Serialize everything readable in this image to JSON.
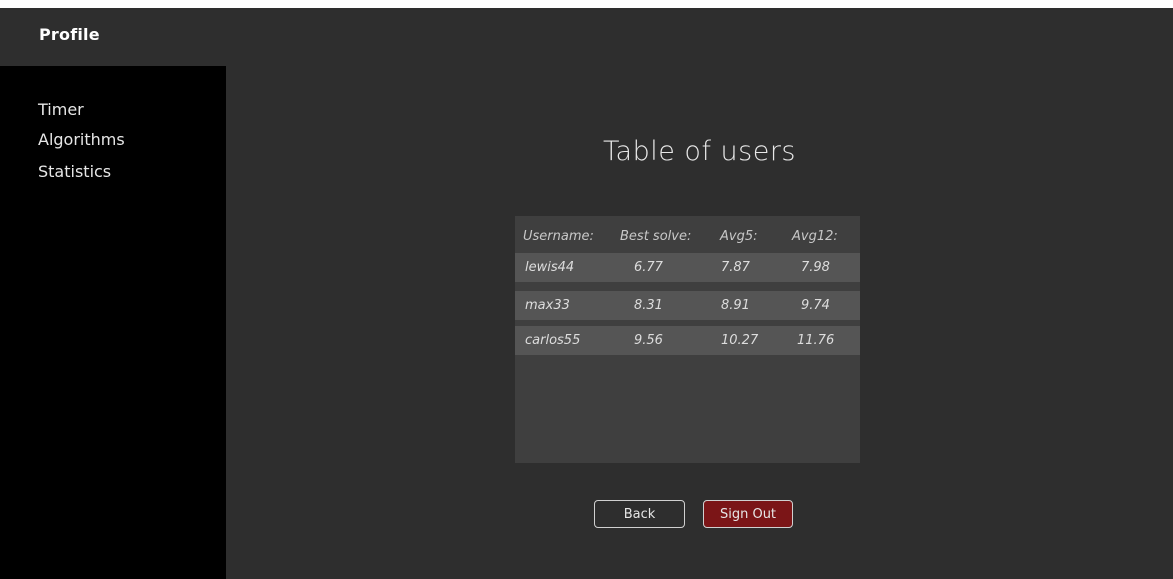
{
  "header": {
    "title": "Profile"
  },
  "sidebar": {
    "items": [
      {
        "label": "Timer"
      },
      {
        "label": "Algorithms"
      },
      {
        "label": "Statistics"
      }
    ]
  },
  "main": {
    "title": "Table of users",
    "table": {
      "columns": [
        "Username:",
        "Best solve:",
        "Avg5:",
        "Avg12:"
      ],
      "rows": [
        [
          "lewis44",
          "6.77",
          "7.87",
          "7.98"
        ],
        [
          "max33",
          "8.31",
          "8.91",
          "9.74"
        ],
        [
          "carlos55",
          "9.56",
          "10.27",
          "11.76"
        ]
      ]
    },
    "buttons": {
      "back_label": "Back",
      "signout_label": "Sign Out"
    }
  },
  "colors": {
    "background": "#2e2e2e",
    "sidebar": "#000000",
    "table_bg": "#3f3f3f",
    "row_bg": "#555555",
    "signout_accent": "#7b1517"
  }
}
